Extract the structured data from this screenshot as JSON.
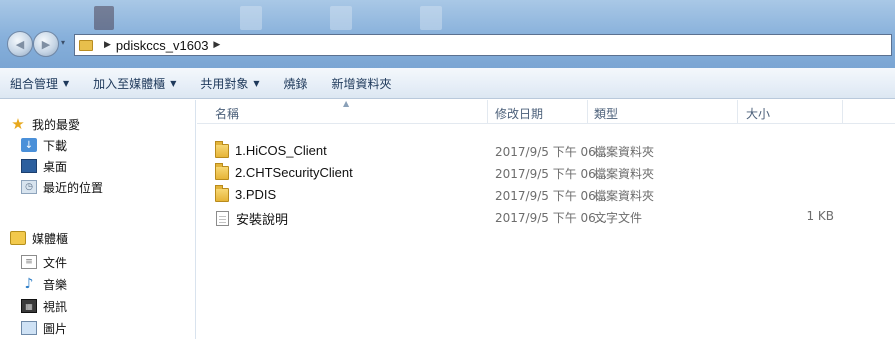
{
  "address_bar": {
    "breadcrumb": "pdiskccs_v1603"
  },
  "toolbar": {
    "items": [
      {
        "label": "組合管理",
        "dropdown": true
      },
      {
        "label": "加入至媒體櫃",
        "dropdown": true
      },
      {
        "label": "共用對象",
        "dropdown": true
      },
      {
        "label": "燒錄",
        "dropdown": false
      },
      {
        "label": "新增資料夾",
        "dropdown": false
      }
    ]
  },
  "nav_pane": {
    "favorites": {
      "label": "我的最愛",
      "icon": "star-icon"
    },
    "favorite_items": [
      {
        "label": "下載",
        "icon": "downloads-icon"
      },
      {
        "label": "桌面",
        "icon": "desktop-icon"
      },
      {
        "label": "最近的位置",
        "icon": "recent-places-icon"
      }
    ],
    "libraries": {
      "label": "媒體櫃",
      "icon": "library-icon"
    },
    "library_items": [
      {
        "label": "文件",
        "icon": "documents-icon"
      },
      {
        "label": "音樂",
        "icon": "music-icon"
      },
      {
        "label": "視訊",
        "icon": "video-icon"
      },
      {
        "label": "圖片",
        "icon": "pictures-icon"
      }
    ]
  },
  "columns": {
    "name": "名稱",
    "date": "修改日期",
    "type": "類型",
    "size": "大小"
  },
  "files": [
    {
      "name": "1.HiCOS_Client",
      "date": "2017/9/5 下午 06...",
      "type": "檔案資料夾",
      "size": "",
      "icon": "folder-icon"
    },
    {
      "name": "2.CHTSecurityClient",
      "date": "2017/9/5 下午 06...",
      "type": "檔案資料夾",
      "size": "",
      "icon": "folder-icon"
    },
    {
      "name": "3.PDIS",
      "date": "2017/9/5 下午 06...",
      "type": "檔案資料夾",
      "size": "",
      "icon": "folder-icon"
    },
    {
      "name": "安裝說明",
      "date": "2017/9/5 下午 06...",
      "type": "文字文件",
      "size": "1 KB",
      "icon": "text-file-icon"
    }
  ],
  "colors": {
    "address_gradient_top": "#a9c8e6",
    "toolbar_text": "#1e395b",
    "folder_yellow": "#e6b437"
  }
}
